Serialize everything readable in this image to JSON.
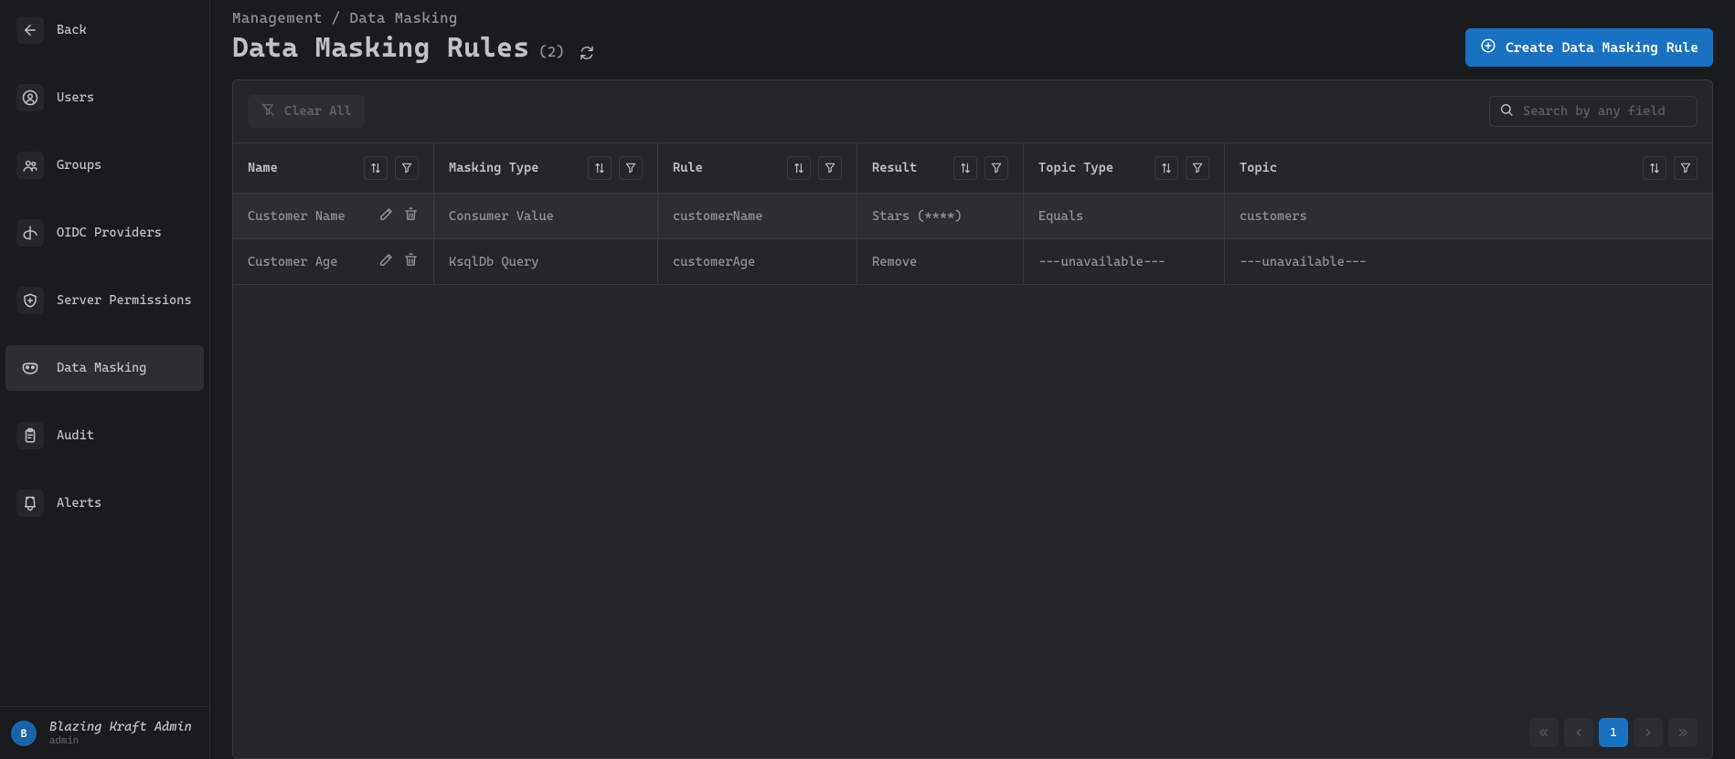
{
  "sidebar": {
    "back_label": "Back",
    "items": [
      {
        "label": "Users",
        "icon": "user-circle-icon"
      },
      {
        "label": "Groups",
        "icon": "users-icon"
      },
      {
        "label": "OIDC Providers",
        "icon": "openid-icon"
      },
      {
        "label": "Server Permissions",
        "icon": "shield-plus-icon"
      },
      {
        "label": "Data Masking",
        "icon": "mask-icon"
      },
      {
        "label": "Audit",
        "icon": "clipboard-icon"
      },
      {
        "label": "Alerts",
        "icon": "alert-icon"
      }
    ],
    "active_index": 4,
    "user": {
      "initial": "B",
      "name": "Blazing Kraft Admin",
      "role": "admin"
    }
  },
  "breadcrumb": {
    "parent": "Management",
    "sep": "/",
    "current": "Data Masking"
  },
  "title": "Data Masking Rules",
  "count_text": "(2)",
  "create_label": "Create Data Masking Rule",
  "clear_label": "Clear All",
  "search_placeholder": "Search by any field",
  "columns": [
    "Name",
    "Masking Type",
    "Rule",
    "Result",
    "Topic Type",
    "Topic"
  ],
  "rows": [
    {
      "name": "Customer Name",
      "masking_type": "Consumer Value",
      "rule": "customerName",
      "result": "Stars (****)",
      "topic_type": "Equals",
      "topic": "customers"
    },
    {
      "name": "Customer Age",
      "masking_type": "KsqlDb Query",
      "rule": "customerAge",
      "result": "Remove",
      "topic_type": "---unavailable---",
      "topic": "---unavailable---"
    }
  ],
  "pager": {
    "current": "1"
  }
}
